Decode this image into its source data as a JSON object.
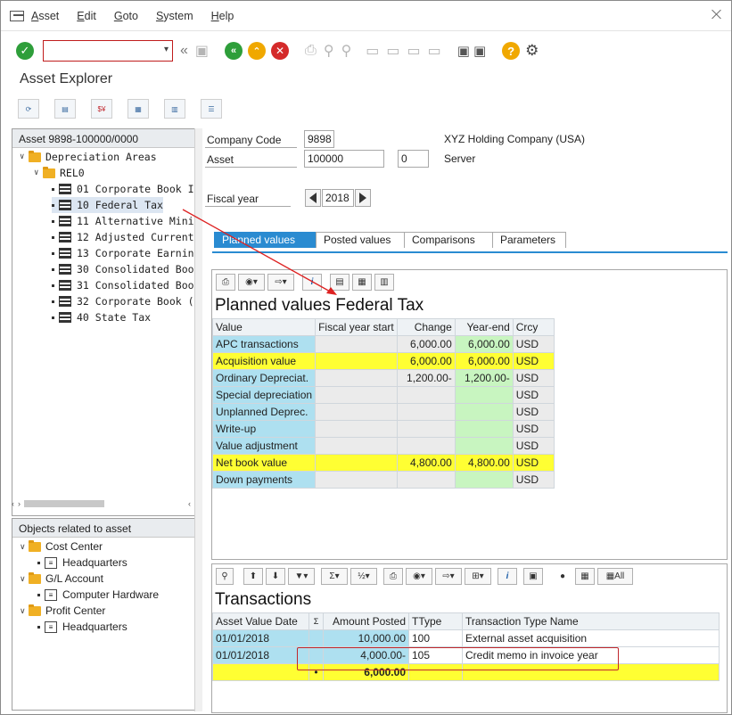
{
  "menu": {
    "items": [
      "Asset",
      "Edit",
      "Goto",
      "System",
      "Help"
    ]
  },
  "toolbar": {
    "command_value": ""
  },
  "page_title": "Asset Explorer",
  "tree": {
    "header": "Asset 9898-100000/0000",
    "root": "Depreciation Areas",
    "sub": "REL0",
    "items": [
      "01 Corporate Book I",
      "10 Federal Tax",
      "11 Alternative Mini",
      "12 Adjusted Current",
      "13 Corporate Earnin",
      "30 Consolidated Boo",
      "31 Consolidated Boo",
      "32 Corporate Book (",
      "40 State Tax"
    ],
    "selected": "10 Federal Tax"
  },
  "objects": {
    "header": "Objects related to asset",
    "groups": [
      {
        "label": "Cost Center",
        "child": "Headquarters"
      },
      {
        "label": "G/L Account",
        "child": "Computer Hardware"
      },
      {
        "label": "Profit Center",
        "child": "Headquarters"
      }
    ]
  },
  "form": {
    "company_code_label": "Company Code",
    "company_code_value": "9898",
    "company_name": "XYZ Holding Company (USA)",
    "asset_label": "Asset",
    "asset_value": "100000",
    "asset_sub": "0",
    "asset_desc": "Server",
    "fiscal_year_label": "Fiscal year",
    "fiscal_year_value": "2018"
  },
  "tabs": [
    "Planned values",
    "Posted values",
    "Comparisons",
    "Parameters"
  ],
  "planned": {
    "title": "Planned values Federal Tax",
    "columns": [
      "Value",
      "Fiscal year start",
      "Change",
      "Year-end",
      "Crcy"
    ],
    "rows": [
      {
        "label": "APC transactions",
        "fys": "",
        "change": "6,000.00",
        "yearend": "6,000.00",
        "crcy": "USD",
        "style": "normal"
      },
      {
        "label": "Acquisition value",
        "fys": "",
        "change": "6,000.00",
        "yearend": "6,000.00",
        "crcy": "USD",
        "style": "yellow"
      },
      {
        "label": "Ordinary Depreciat.",
        "fys": "",
        "change": "1,200.00-",
        "yearend": "1,200.00-",
        "crcy": "USD",
        "style": "normal"
      },
      {
        "label": "Special depreciation",
        "fys": "",
        "change": "",
        "yearend": "",
        "crcy": "USD",
        "style": "normal"
      },
      {
        "label": "Unplanned Deprec.",
        "fys": "",
        "change": "",
        "yearend": "",
        "crcy": "USD",
        "style": "normal"
      },
      {
        "label": "Write-up",
        "fys": "",
        "change": "",
        "yearend": "",
        "crcy": "USD",
        "style": "normal"
      },
      {
        "label": "Value adjustment",
        "fys": "",
        "change": "",
        "yearend": "",
        "crcy": "USD",
        "style": "normal"
      },
      {
        "label": "Net book value",
        "fys": "",
        "change": "4,800.00",
        "yearend": "4,800.00",
        "crcy": "USD",
        "style": "yellow"
      },
      {
        "label": "Down payments",
        "fys": "",
        "change": "",
        "yearend": "",
        "crcy": "USD",
        "style": "normal"
      }
    ]
  },
  "transactions": {
    "title": "Transactions",
    "toolbar_all_label": "All",
    "columns": [
      "Asset Value Date",
      "Σ",
      "Amount Posted",
      "TType",
      "Transaction Type Name"
    ],
    "rows": [
      {
        "date": "01/01/2018",
        "amount": "10,000.00",
        "ttype": "100",
        "name": "External asset acquisition"
      },
      {
        "date": "01/01/2018",
        "amount": "4,000.00-",
        "ttype": "105",
        "name": "Credit memo in invoice year"
      }
    ],
    "total_marker": "•",
    "total": "6,000.00"
  }
}
